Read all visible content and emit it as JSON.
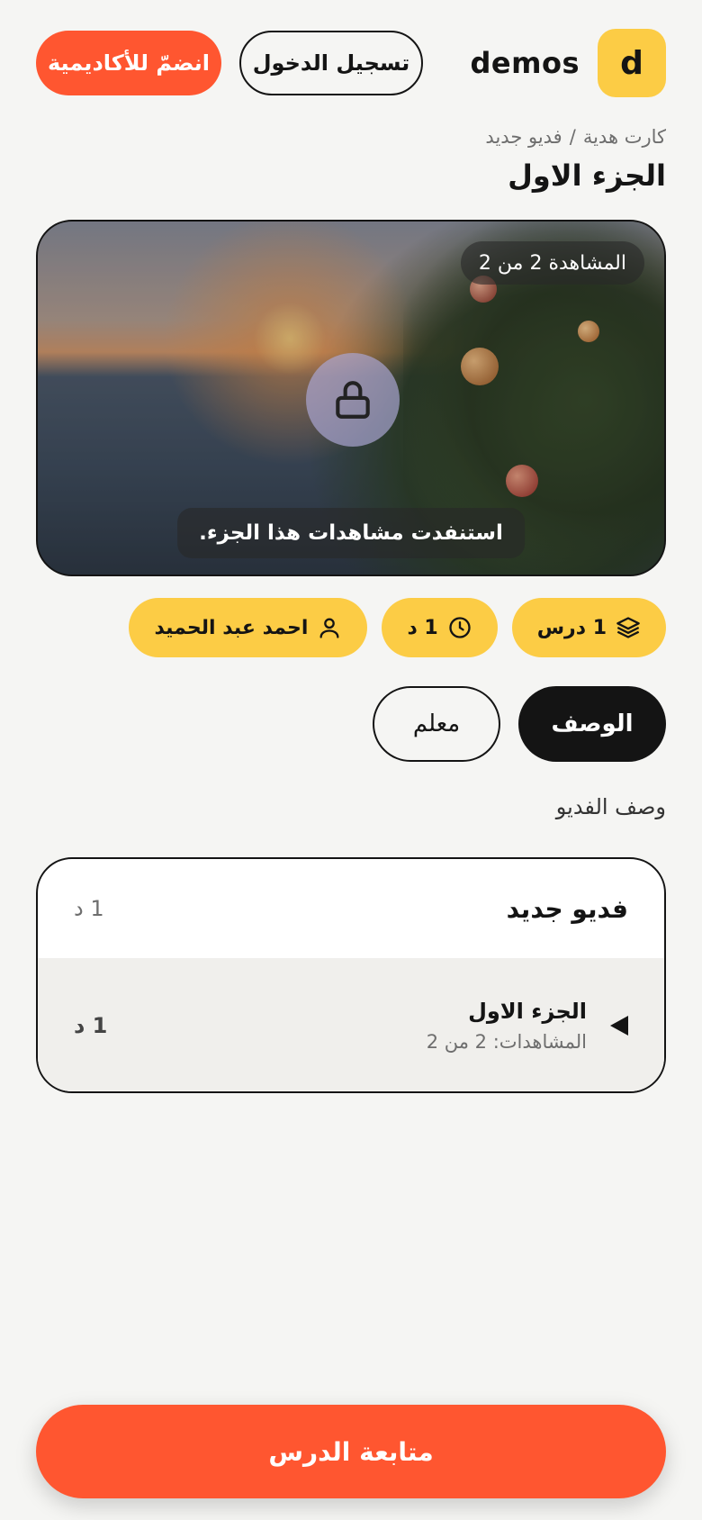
{
  "header": {
    "logo_letter": "d",
    "brand_name": "demos",
    "login_label": "تسجيل الدخول",
    "join_label": "انضمّ للأكاديمية"
  },
  "breadcrumb": {
    "items": [
      "كارت هدية",
      "فديو جديد"
    ],
    "separator": "/"
  },
  "page_title": "الجزء الاول",
  "video": {
    "views_badge": "المشاهدة 2 من 2",
    "locked": true,
    "exhausted_message": "استنفدت مشاهدات هذا الجزء."
  },
  "meta_chips": {
    "lessons": "1 درس",
    "duration": "1 د",
    "instructor": "احمد عبد الحميد"
  },
  "tabs": [
    {
      "label": "الوصف",
      "active": true
    },
    {
      "label": "معلم",
      "active": false
    }
  ],
  "description": "وصف الفديو",
  "lessons_list": {
    "title": "فديو جديد",
    "duration": "1 د",
    "items": [
      {
        "title": "الجزء الاول",
        "views": "المشاهدات: 2 من 2",
        "duration": "1 د"
      }
    ]
  },
  "cta_label": "متابعة الدرس",
  "colors": {
    "accent": "#ff5630",
    "yellow": "#fccc45",
    "dark": "#141414",
    "background": "#f5f5f3"
  },
  "icons": {
    "lessons": "layers-icon",
    "duration": "clock-icon",
    "instructor": "user-icon",
    "lock": "lock-icon",
    "play": "play-icon"
  }
}
